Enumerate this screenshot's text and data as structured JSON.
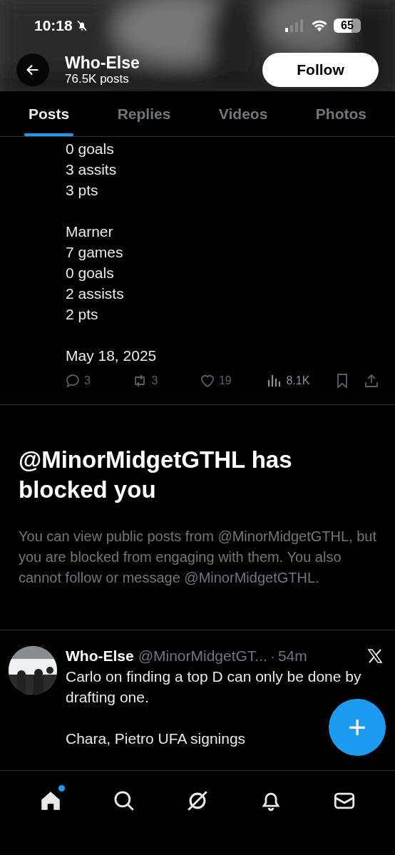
{
  "status_bar": {
    "time": "10:18",
    "silenced": true,
    "battery": "65"
  },
  "header": {
    "title": "Who-Else",
    "subtitle": "76.5K posts",
    "follow_button": "Follow"
  },
  "tabs": [
    {
      "label": "Posts",
      "selected": true
    },
    {
      "label": "Replies",
      "selected": false
    },
    {
      "label": "Videos",
      "selected": false
    },
    {
      "label": "Photos",
      "selected": false
    }
  ],
  "post": {
    "paragraphs": [
      "0 goals\n3 assits\n3 pts",
      "Marner\n7 games\n0 goals\n2 assists\n2 pts",
      "May 18, 2025"
    ],
    "actions": [
      {
        "kind": "reply",
        "count": "3"
      },
      {
        "kind": "repost",
        "count": "3"
      },
      {
        "kind": "like",
        "count": "19"
      },
      {
        "kind": "views",
        "count": "8.1K"
      },
      {
        "kind": "bookmark"
      },
      {
        "kind": "share"
      }
    ]
  },
  "blocked_notice": {
    "title": "@MinorMidgetGTHL has blocked you",
    "message": "You can view public posts from @MinorMidgetGTHL, but you are blocked from engaging with them. You also cannot follow or message @MinorMidgetGTHL."
  },
  "tweet": {
    "name": "Who-Else",
    "handle": "@MinorMidgetGT...",
    "separator": "·",
    "time": "54m",
    "paragraphs": [
      "Carlo on finding a top D can only be done by drafting one.",
      "Chara, Pietro UFA signings"
    ]
  },
  "compose_button": "+",
  "bottom_nav": [
    {
      "kind": "home",
      "selected": true,
      "badge": true
    },
    {
      "kind": "search",
      "selected": false,
      "badge": false
    },
    {
      "kind": "grok",
      "selected": false,
      "badge": false
    },
    {
      "kind": "notifications",
      "selected": false,
      "badge": false
    },
    {
      "kind": "messages",
      "selected": false,
      "badge": false
    }
  ]
}
